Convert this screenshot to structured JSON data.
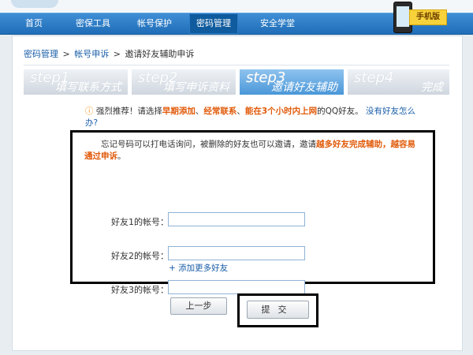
{
  "nav": {
    "items": [
      {
        "label": "首页"
      },
      {
        "label": "密保工具"
      },
      {
        "label": "帐号保护"
      },
      {
        "label": "密码管理"
      },
      {
        "label": "安全学堂"
      }
    ],
    "mobile_label": "手机版"
  },
  "breadcrumb": [
    "密码管理",
    ">",
    "帐号申诉",
    ">",
    "邀请好友辅助申诉"
  ],
  "steps": [
    {
      "en": "step1",
      "cn": "填写联系方式"
    },
    {
      "en": "step2",
      "cn": "填写申诉资料"
    },
    {
      "en": "step3",
      "cn": "邀请好友辅助"
    },
    {
      "en": "step4",
      "cn": "完成"
    }
  ],
  "tip": {
    "icon": "warning-icon",
    "prefix": "强烈推荐！请选择",
    "h1": "早期添加",
    "sep1": "、",
    "h2": "经常联系",
    "sep2": "、",
    "h3": "能在3个小时内上网",
    "suffix": "的QQ好友。",
    "link": "没有好友怎么办?"
  },
  "note": {
    "text": "忘记号码可以打电话询问，被删除的好友也可以邀请，邀请",
    "highlight": "越多好友完成辅助，越容易通过申诉",
    "end": "。"
  },
  "fields": [
    {
      "label": "好友1的帐号：",
      "value": ""
    },
    {
      "label": "好友2的帐号：",
      "value": ""
    },
    {
      "label": "好友3的帐号：",
      "value": ""
    }
  ],
  "add_more": "+ 添加更多好友",
  "buttons": {
    "prev": "上一步",
    "submit": "提交"
  }
}
